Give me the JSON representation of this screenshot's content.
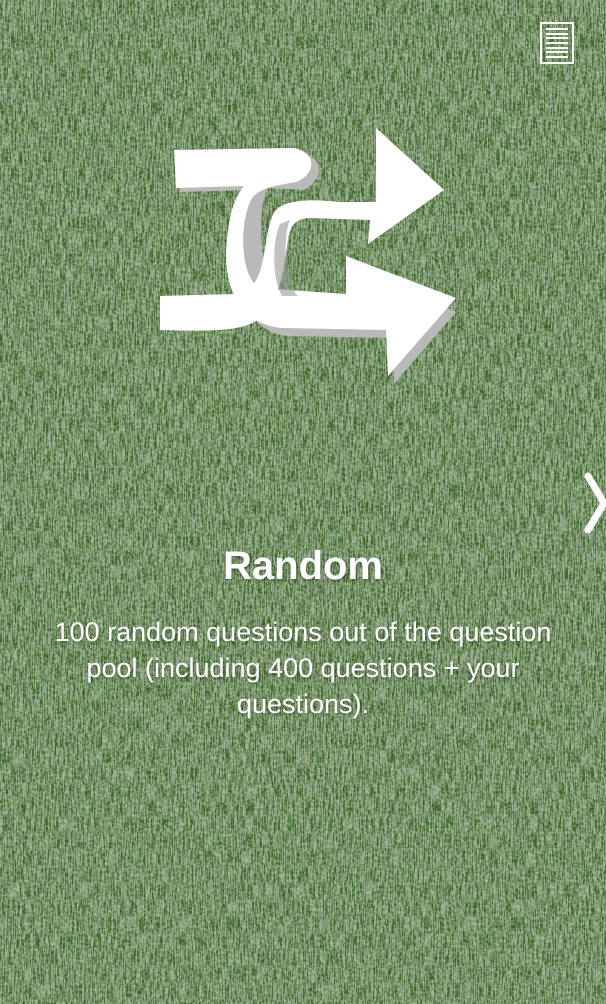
{
  "theme": {
    "background_color": "#3e6629",
    "foreground_color": "#ffffff"
  },
  "header": {
    "menu_icon": "menu-list-icon"
  },
  "carousel": {
    "current_slide": {
      "icon": "shuffle-icon",
      "title": "Random",
      "description": "100 random questions out of the question pool (including 400 questions + your questions)."
    },
    "next_icon": "chevron-right-icon"
  }
}
